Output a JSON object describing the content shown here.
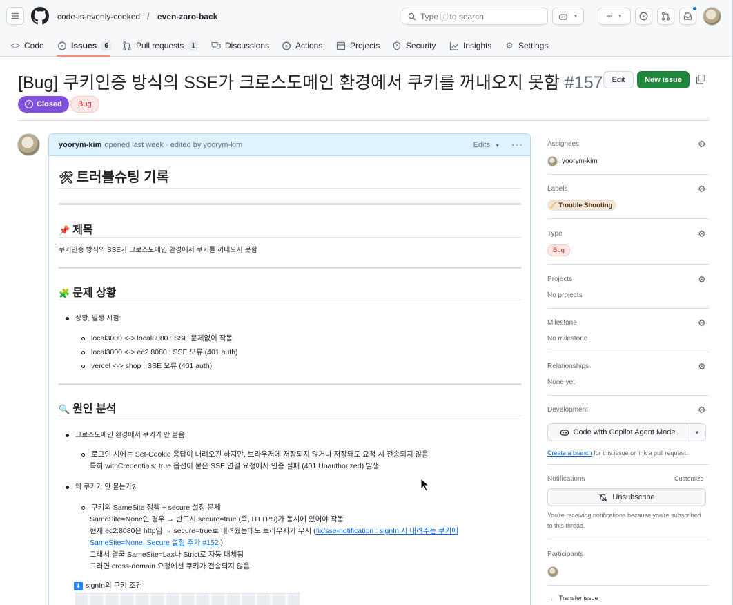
{
  "header": {
    "owner": "code-is-evenly-cooked",
    "separator": "/",
    "repo": "even-zaro-back",
    "search_prefix": "Type",
    "search_key": "/",
    "search_suffix": "to search"
  },
  "tabs": [
    {
      "label": "Code",
      "icon": "code-icon"
    },
    {
      "label": "Issues",
      "count": "6",
      "icon": "issue-icon"
    },
    {
      "label": "Pull requests",
      "count": "1",
      "icon": "pull-request-icon"
    },
    {
      "label": "Discussions",
      "icon": "discussion-icon"
    },
    {
      "label": "Actions",
      "icon": "play-icon"
    },
    {
      "label": "Projects",
      "icon": "table-icon"
    },
    {
      "label": "Security",
      "icon": "shield-icon"
    },
    {
      "label": "Insights",
      "icon": "graph-icon"
    },
    {
      "label": "Settings",
      "icon": "gear-icon"
    }
  ],
  "issue": {
    "title": "[Bug] 쿠키인증 방식의 SSE가 크로스도메인 환경에서 쿠키를 꺼내오지 못함",
    "number": "#157",
    "edit_label": "Edit",
    "new_issue_label": "New issue",
    "state": "Closed",
    "label": "Bug"
  },
  "comment": {
    "author": "yoorym-kim",
    "meta": "opened last week · edited by yoorym-kim",
    "edits_label": "Edits",
    "more": "···",
    "heading": "트러블슈팅 기록",
    "section1_title": "제목",
    "section1_text": "쿠키인증 방식의 SSE가 크로스도메인 환경에서 쿠키를 꺼내오지 못함",
    "section2_title": "문제 상황",
    "section2_item": "상황, 발생 시점:",
    "section2_subs": [
      "local3000 <-> local8080 : SSE 문제없이 작동",
      "local3000 <-> ec2 8080 : SSE 오류 (401 auth)",
      "vercel <-> shop : SSE 오류 (401 auth)"
    ],
    "section3_title": "원인 분석",
    "cause1": "크로스도메인 환경에서 쿠키가 안 붙음",
    "cause1_sub1": "로그인 시에는 Set-Cookie 응답이 내려오긴 하지만, 브라우저에 저장되지 않거나 저장돼도 요청 시 전송되지 않음",
    "cause1_sub2": "특히 withCredentials: true 옵션이 붙은 SSE 연결 요청에서 인증 실패 (401 Unauthorized) 발생",
    "cause2": "왜 쿠키가 안 붙는가?",
    "cause2_sub1": "쿠키의 SameSite 정책 + secure 설정 문제",
    "cause2_sub2": "SameSite=None인 경우 → 반드시 secure=true (즉, HTTPS)가 동시에 있어야 작동",
    "cause2_sub3_pre": "현재 ec2:8080은 http임 → secure=true로 내려줬는데도 브라우저가 무시 (",
    "cause2_sub3_link1": "fix/sse-notification : signIn 시 내려주는 쿠키에",
    "cause2_sub3_link2": "SameSite=None; Secure 설정 추가 #152",
    "cause2_sub3_post": ")",
    "cause2_sub4": "그래서 결국 SameSite=Lax나 Strict로 자동 대체됨",
    "cause2_sub5": "그러면 cross-domain 요청에선 쿠키가 전송되지 않음",
    "signin_caption": "signIn의 쿠키 조건"
  },
  "sidebar": {
    "assignees_title": "Assignees",
    "assignee": "yoorym-kim",
    "labels_title": "Labels",
    "label_value": "Trouble Shooting",
    "type_title": "Type",
    "type_value": "Bug",
    "projects_title": "Projects",
    "projects_value": "No projects",
    "milestone_title": "Milestone",
    "milestone_value": "No milestone",
    "relationships_title": "Relationships",
    "relationships_value": "None yet",
    "development_title": "Development",
    "copilot_label": "Code with Copilot Agent Mode",
    "create_branch_link": "Create a branch",
    "create_branch_rest": "for this issue or link a pull request.",
    "notifications_title": "Notifications",
    "customize_label": "Customize",
    "unsubscribe_label": "Unsubscribe",
    "notif_text1": "You're receiving notifications because you're subscribed",
    "notif_text2": "to this thread.",
    "participants_title": "Participants",
    "transfer_label": "Transfer issue"
  },
  "colors": {
    "closed": "#8250df",
    "new_issue": "#1f883d",
    "tab_underline": "#fd8c73",
    "link": "#0969da"
  }
}
